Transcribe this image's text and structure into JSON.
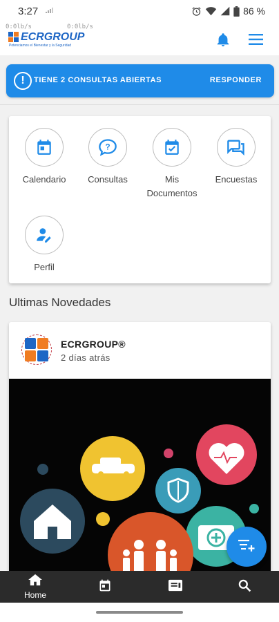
{
  "status_bar": {
    "time": "3:27",
    "battery": "86 %"
  },
  "header": {
    "net_speed_1": "0:0lb/s",
    "net_speed_2": "0:0lb/s",
    "logo_text": "ECRGROUP",
    "logo_tagline": "Potenciamos el Bienestar y la Seguridad"
  },
  "banner": {
    "icon": "!",
    "message": "TIENE 2 CONSULTAS ABIERTAS",
    "action": "RESPONDER"
  },
  "menu": {
    "items": [
      {
        "label": "Calendario",
        "icon": "calendar-icon"
      },
      {
        "label": "Consultas",
        "icon": "question-chat-icon"
      },
      {
        "label": "Mis Documentos",
        "icon": "calendar-check-icon"
      },
      {
        "label": "Encuestas",
        "icon": "forum-icon"
      },
      {
        "label": "Perfil",
        "icon": "person-edit-icon"
      }
    ]
  },
  "news": {
    "section_title": "Ultimas Novedades",
    "post": {
      "author": "ECRGROUP®",
      "time": "2 días atrás"
    }
  },
  "bottom_nav": {
    "items": [
      {
        "label": "Home",
        "icon": "home-icon"
      },
      {
        "label": "",
        "icon": "calendar-icon"
      },
      {
        "label": "",
        "icon": "news-icon"
      },
      {
        "label": "",
        "icon": "search-icon"
      }
    ]
  },
  "colors": {
    "primary": "#1f8be8",
    "logo_orange": "#f07c22",
    "logo_blue": "#1e66c5",
    "nav_bg": "#2b2b2b"
  }
}
